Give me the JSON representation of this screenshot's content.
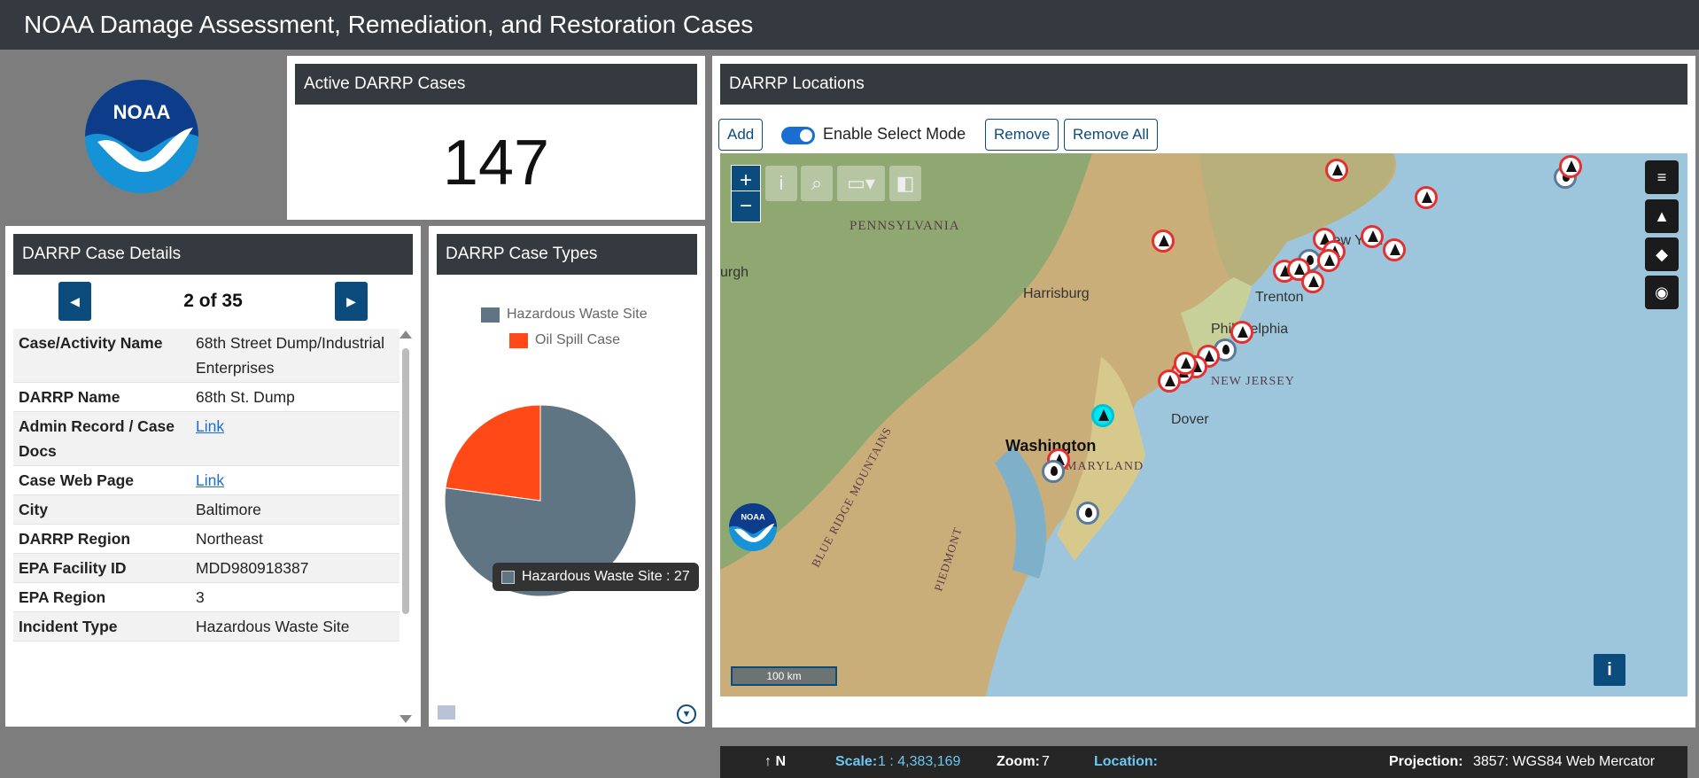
{
  "app": {
    "title": "NOAA Damage Assessment, Remediation, and Restoration Cases"
  },
  "counter": {
    "title": "Active DARRP Cases",
    "value": "147"
  },
  "details": {
    "title": "DARRP Case Details",
    "pager": "2 of 35",
    "rows": [
      {
        "key": "Case/Activity Name",
        "value": "68th Street Dump/Industrial Enterprises"
      },
      {
        "key": "DARRP Name",
        "value": "68th St. Dump"
      },
      {
        "key": "Admin Record / Case Docs",
        "value": "Link",
        "link": true
      },
      {
        "key": "Case Web Page",
        "value": "Link",
        "link": true
      },
      {
        "key": "City",
        "value": "Baltimore"
      },
      {
        "key": "DARRP Region",
        "value": "Northeast"
      },
      {
        "key": "EPA Facility ID",
        "value": "MDD980918387"
      },
      {
        "key": "EPA Region",
        "value": "3"
      },
      {
        "key": "Incident Type",
        "value": "Hazardous Waste Site"
      }
    ]
  },
  "types": {
    "title": "DARRP Case Types",
    "legend": [
      {
        "label": "Hazardous Waste Site",
        "color": "#607583"
      },
      {
        "label": "Oil Spill Case",
        "color": "#ff4a17"
      }
    ],
    "tooltip": "Hazardous Waste Site : 27"
  },
  "chart_data": {
    "type": "pie",
    "categories": [
      "Hazardous Waste Site",
      "Oil Spill Case"
    ],
    "values": [
      27,
      8
    ],
    "colors": [
      "#607583",
      "#ff4a17"
    ]
  },
  "map": {
    "title": "DARRP Locations",
    "buttons": {
      "add": "Add",
      "select_mode": "Enable Select Mode",
      "remove": "Remove",
      "remove_all": "Remove All"
    },
    "labels": {
      "pennsylvania": "PENNSYLVANIA",
      "pittsburgh": "urgh",
      "harrisburg": "Harrisburg",
      "trenton": "Trenton",
      "philadelphia": "Philadelphia",
      "new_jersey": "NEW JERSEY",
      "new_york": "New York",
      "dover": "Dover",
      "washington": "Washington",
      "maryland": "MARYLAND",
      "blue_ridge": "BLUE RIDGE MOUNTAINS",
      "piedmont": "PIEDMONT"
    },
    "scalebar": "100 km",
    "status": {
      "north": "↑ N",
      "scale_label": "Scale:",
      "scale_value": "1 : 4,383,169",
      "zoom_label": "Zoom:",
      "zoom_value": "7",
      "location_label": "Location:",
      "projection_label": "Projection:",
      "projection_value": "3857: WGS84 Web Mercator"
    }
  }
}
